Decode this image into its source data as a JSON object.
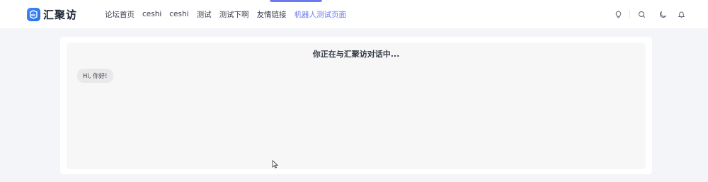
{
  "header": {
    "brand_name": "汇聚访",
    "nav_items": [
      {
        "label": "论坛首页"
      },
      {
        "label": "ceshi"
      },
      {
        "label": "ceshi"
      },
      {
        "label": "测试"
      },
      {
        "label": "测试下啊"
      },
      {
        "label": "友情链接"
      },
      {
        "label": "机器人测试页面",
        "active": true
      }
    ],
    "icons": [
      "lightbulb-icon",
      "search-icon",
      "moon-icon",
      "bell-icon"
    ],
    "accent_color": "#6d79f0"
  },
  "chat": {
    "title": "你正在与汇聚访对话中...",
    "messages": [
      {
        "from": "bot",
        "text": "Hi, 你好!"
      }
    ]
  }
}
